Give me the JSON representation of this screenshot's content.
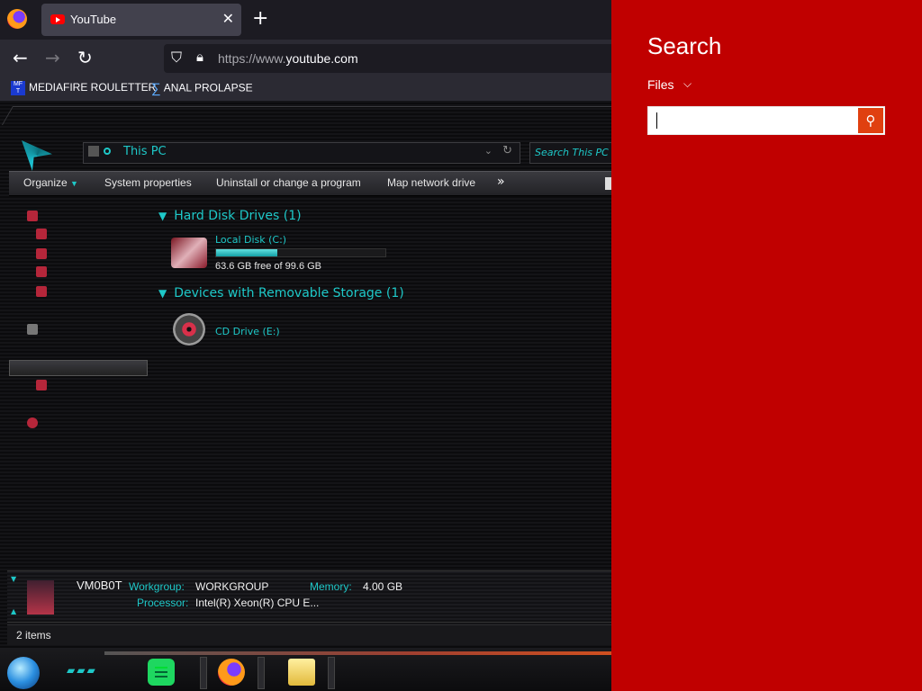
{
  "browser": {
    "tab": {
      "title": "YouTube",
      "close": "✕"
    },
    "new_tab": "+",
    "nav": {
      "back": "←",
      "forward": "→",
      "reload": "↻"
    },
    "url": {
      "prefix": "https://www.",
      "domain": "youtube.com"
    },
    "bookmarks": [
      {
        "label": "MEDIAFIRE ROULETTER",
        "icon": "MF T"
      },
      {
        "label": "ANAL PROLAPSE",
        "icon": "∑"
      }
    ]
  },
  "explorer": {
    "address": "This PC",
    "search_placeholder": "Search This PC",
    "commands": {
      "organize": "Organize",
      "system_properties": "System properties",
      "uninstall": "Uninstall or change a program",
      "map_drive": "Map network drive",
      "more": "»"
    },
    "groups": {
      "hard_disks": "Hard Disk Drives (1)",
      "removable": "Devices with Removable Storage (1)"
    },
    "drive_c": {
      "name": "Local Disk (C:)",
      "info": "63.6 GB free of 99.6 GB",
      "used_fraction": 0.36
    },
    "cd_drive": {
      "name": "CD Drive (E:)"
    },
    "details": {
      "computer_name": "VM0B0T",
      "workgroup_label": "Workgroup:",
      "workgroup": "WORKGROUP",
      "memory_label": "Memory:",
      "memory": "4.00 GB",
      "processor_label": "Processor:",
      "processor": "Intel(R) Xeon(R) CPU E..."
    },
    "status": "2 items"
  },
  "search_charm": {
    "title": "Search",
    "scope": "Files",
    "query": ""
  },
  "colors": {
    "accent_cyan": "#1ec8c8",
    "charm_red": "#c00000",
    "search_go": "#e04010"
  }
}
